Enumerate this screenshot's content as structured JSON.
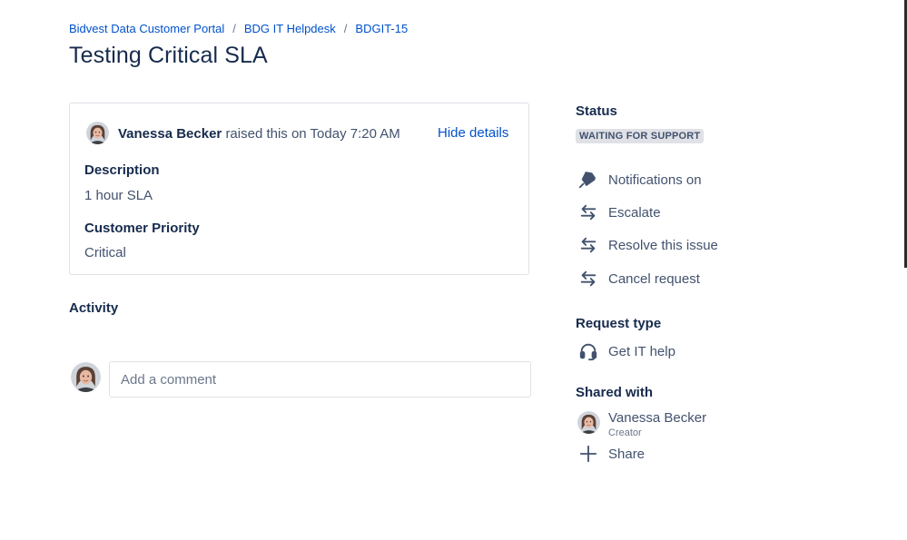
{
  "breadcrumb": {
    "items": [
      "Bidvest Data Customer Portal",
      "BDG IT Helpdesk",
      "BDGIT-15"
    ],
    "separator": "/"
  },
  "title": "Testing Critical SLA",
  "details": {
    "raiser_name": "Vanessa Becker",
    "raised_text": "raised this on Today 7:20 AM",
    "hide_details_label": "Hide details",
    "fields": [
      {
        "label": "Description",
        "value": "1 hour SLA"
      },
      {
        "label": "Customer Priority",
        "value": "Critical"
      }
    ]
  },
  "activity": {
    "heading": "Activity",
    "comment_placeholder": "Add a comment"
  },
  "sidebar": {
    "status_heading": "Status",
    "status_value": "WAITING FOR SUPPORT",
    "actions": [
      {
        "label": "Notifications on",
        "icon": "notification-icon"
      },
      {
        "label": "Escalate",
        "icon": "transition-arrows-icon"
      },
      {
        "label": "Resolve this issue",
        "icon": "transition-arrows-icon"
      },
      {
        "label": "Cancel request",
        "icon": "transition-arrows-icon"
      }
    ],
    "request_type_heading": "Request type",
    "request_type": {
      "label": "Get IT help",
      "icon": "headset-icon"
    },
    "shared_with_heading": "Shared with",
    "shared_user": {
      "name": "Vanessa Becker",
      "role": "Creator"
    },
    "share_label": "Share"
  },
  "colors": {
    "link": "#0052cc",
    "text_primary": "#172b4d",
    "text_secondary": "#42526e",
    "border": "#dfe1e6",
    "lozenge_bg": "#dfe1e6"
  }
}
